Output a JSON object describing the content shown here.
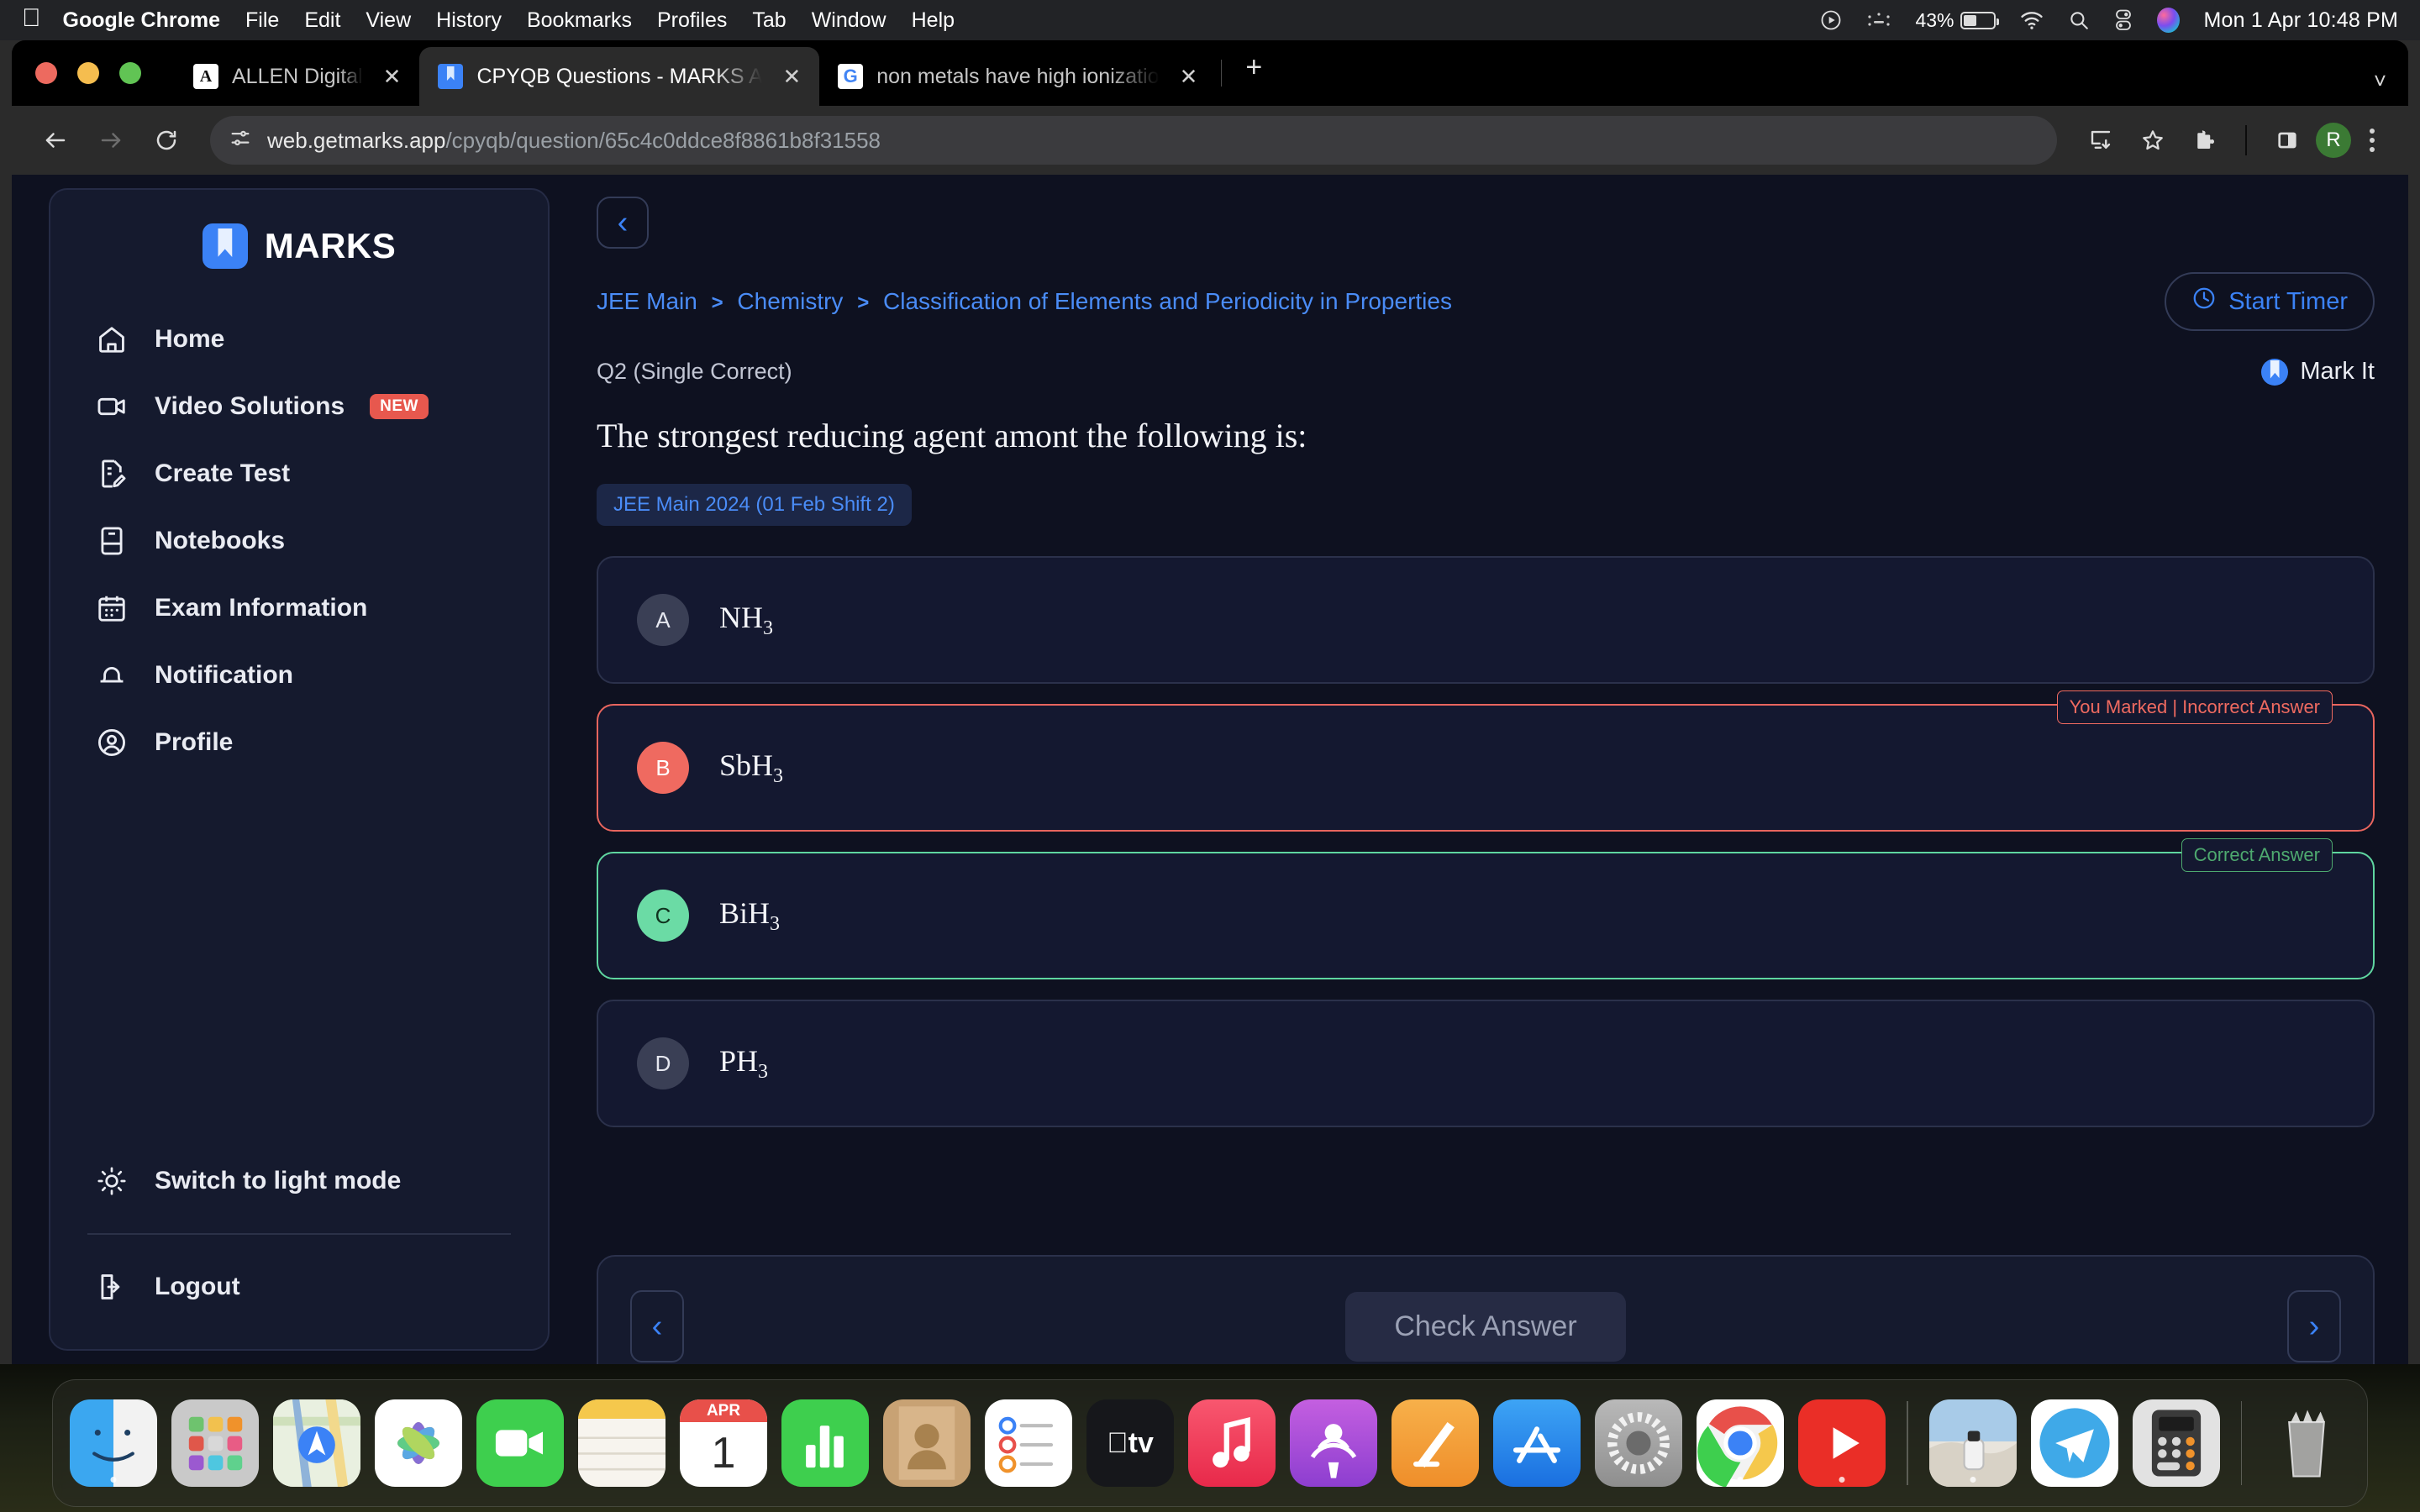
{
  "menubar": {
    "apple_icon": "apple-icon",
    "items": [
      "Google Chrome",
      "File",
      "Edit",
      "View",
      "History",
      "Bookmarks",
      "Profiles",
      "Tab",
      "Window",
      "Help"
    ],
    "status": {
      "screenrec_icon": "play-circle-icon",
      "dots_icon": "dots-status-icon",
      "battery_percent": "43%",
      "battery_icon": "battery-icon",
      "wifi_icon": "wifi-icon",
      "search_icon": "search-icon",
      "control_center_icon": "control-center-icon",
      "siri_icon": "siri-icon",
      "clock": "Mon 1 Apr  10:48 PM"
    }
  },
  "browser": {
    "tabs": [
      {
        "title": "ALLEN Digital",
        "favicon": "allen-favicon",
        "active": false,
        "close_icon": "close-icon"
      },
      {
        "title": "CPYQB Questions - MARKS A",
        "favicon": "marks-favicon",
        "active": true,
        "close_icon": "close-icon"
      },
      {
        "title": "non metals have high ionizatio",
        "favicon": "google-favicon",
        "active": false,
        "close_icon": "close-icon"
      }
    ],
    "new_tab_label": "+",
    "window_chevron_icon": "chevron-down-icon",
    "toolbar": {
      "back_icon": "arrow-left-icon",
      "forward_icon": "arrow-right-icon",
      "reload_icon": "reload-icon",
      "site_info_icon": "tune-icon",
      "url_host": "web.getmarks.app",
      "url_path": "/cpyqb/question/65c4c0ddce8f8861b8f31558",
      "install_icon": "install-app-icon",
      "bookmark_icon": "star-icon",
      "extensions_icon": "puzzle-icon",
      "side_panel_icon": "side-panel-icon",
      "profile_initial": "R",
      "menu_icon": "kebab-menu-icon"
    }
  },
  "sidebar": {
    "brand": "MARKS",
    "brand_icon": "marks-logo-icon",
    "items": [
      {
        "label": "Home",
        "icon": "home-icon"
      },
      {
        "label": "Video Solutions",
        "icon": "video-camera-icon",
        "badge": "NEW"
      },
      {
        "label": "Create Test",
        "icon": "document-edit-icon"
      },
      {
        "label": "Notebooks",
        "icon": "notebook-icon"
      },
      {
        "label": "Exam Information",
        "icon": "calendar-icon"
      },
      {
        "label": "Notification",
        "icon": "bell-icon"
      },
      {
        "label": "Profile",
        "icon": "user-circle-icon"
      }
    ],
    "theme_toggle": {
      "label": "Switch to light mode",
      "icon": "sun-icon"
    },
    "logout": {
      "label": "Logout",
      "icon": "logout-icon"
    }
  },
  "content": {
    "back_icon": "chevron-left-icon",
    "breadcrumb": {
      "items": [
        "JEE Main",
        "Chemistry",
        "Classification of Elements and Periodicity in Properties"
      ],
      "separator": "❯"
    },
    "timer_button": {
      "label": "Start Timer",
      "icon": "clock-icon"
    },
    "question_meta": "Q2 (Single Correct)",
    "mark_it": {
      "label": "Mark It",
      "icon": "bookmark-icon"
    },
    "question_text": "The strongest reducing agent amont the following is:",
    "exam_tag": "JEE Main 2024 (01 Feb Shift 2)",
    "options": [
      {
        "letter": "A",
        "formula": "NH",
        "sub": "3",
        "state": "neutral",
        "flag": null
      },
      {
        "letter": "B",
        "formula": "SbH",
        "sub": "3",
        "state": "wrong",
        "flag": "You Marked | Incorrect Answer"
      },
      {
        "letter": "C",
        "formula": "BiH",
        "sub": "3",
        "state": "right",
        "flag": "Correct Answer"
      },
      {
        "letter": "D",
        "formula": "PH",
        "sub": "3",
        "state": "neutral",
        "flag": null
      }
    ],
    "footer": {
      "prev_icon": "chevron-left-icon",
      "check_label": "Check Answer",
      "next_icon": "chevron-right-icon"
    }
  },
  "dock": {
    "items": [
      {
        "name": "finder",
        "running": true
      },
      {
        "name": "launchpad",
        "running": false
      },
      {
        "name": "maps",
        "running": false
      },
      {
        "name": "photos",
        "running": false
      },
      {
        "name": "facetime",
        "running": false
      },
      {
        "name": "notes",
        "running": false
      },
      {
        "name": "calendar",
        "running": false,
        "month": "APR",
        "day": "1"
      },
      {
        "name": "numbers",
        "running": false
      },
      {
        "name": "contacts",
        "running": false
      },
      {
        "name": "reminders",
        "running": false
      },
      {
        "name": "apple-tv",
        "running": false
      },
      {
        "name": "music",
        "running": false
      },
      {
        "name": "podcasts",
        "running": false
      },
      {
        "name": "freeform",
        "running": false
      },
      {
        "name": "app-store",
        "running": false
      },
      {
        "name": "system-settings",
        "running": false
      },
      {
        "name": "google-chrome",
        "running": true
      },
      {
        "name": "youtube",
        "running": true
      },
      {
        "name": "screenshot-folder",
        "running": true
      },
      {
        "name": "telegram",
        "running": false
      },
      {
        "name": "calculator",
        "running": false
      },
      {
        "name": "trash",
        "running": false
      }
    ]
  }
}
